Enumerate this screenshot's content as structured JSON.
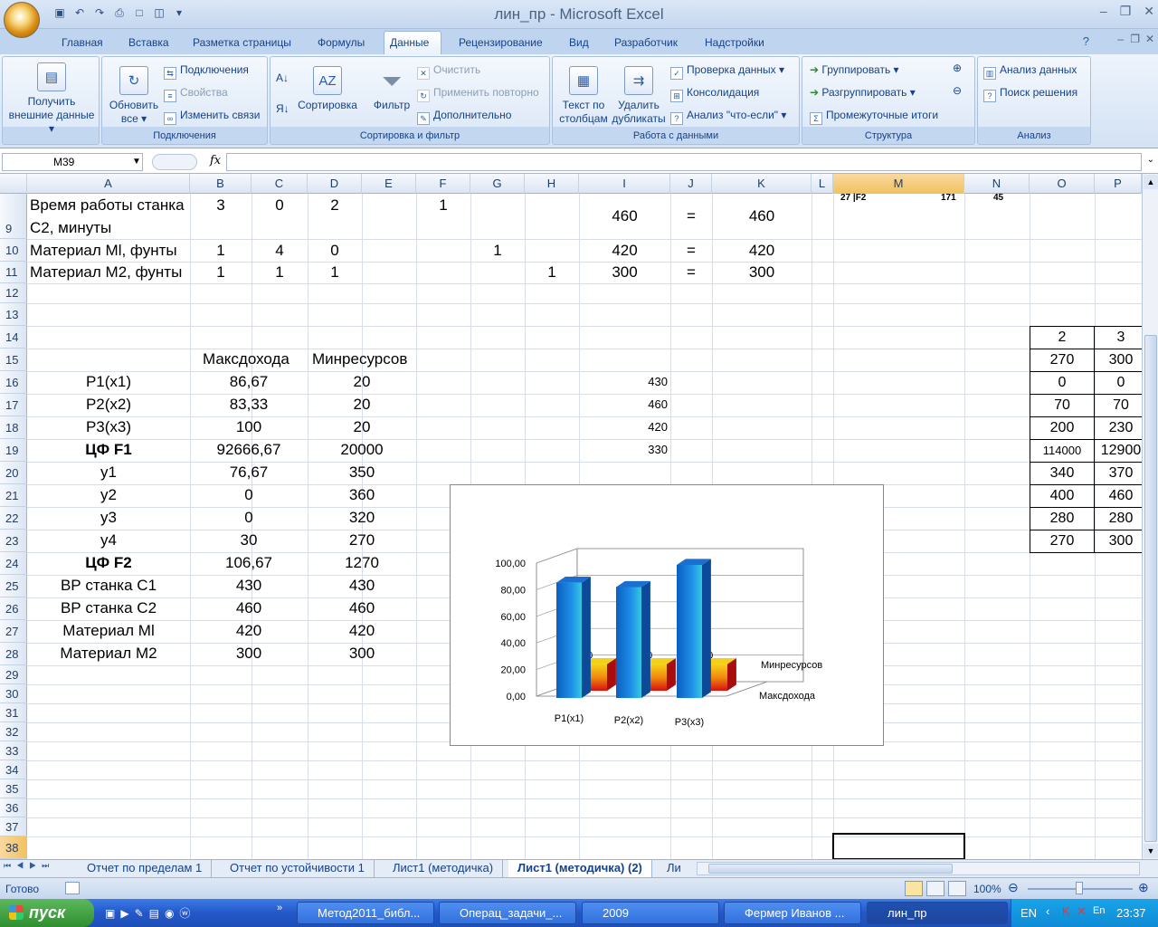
{
  "window": {
    "title": "лин_пр - Microsoft Excel"
  },
  "ribbon": {
    "tabs": [
      "Главная",
      "Вставка",
      "Разметка страницы",
      "Формулы",
      "Данные",
      "Рецензирование",
      "Вид",
      "Разработчик",
      "Надстройки"
    ],
    "active_tab": "Данные",
    "groups": {
      "connections_label": "Подключения",
      "sort_filter_label": "Сортировка и фильтр",
      "data_tools_label": "Работа с данными",
      "structure_label": "Структура",
      "analysis_label": "Анализ"
    },
    "buttons": {
      "get_external_1": "Получить",
      "get_external_2": "внешние данные",
      "refresh_1": "Обновить",
      "refresh_2": "все",
      "connections": "Подключения",
      "properties": "Свойства",
      "edit_links": "Изменить связи",
      "sort": "Сортировка",
      "filter": "Фильтр",
      "clear": "Очистить",
      "reapply": "Применить повторно",
      "advanced": "Дополнительно",
      "text_to_columns_1": "Текст по",
      "text_to_columns_2": "столбцам",
      "remove_dup_1": "Удалить",
      "remove_dup_2": "дубликаты",
      "data_validation": "Проверка данных",
      "consolidate": "Консолидация",
      "what_if": "Анализ \"что-если\"",
      "group": "Группировать",
      "ungroup": "Разгруппировать",
      "subtotal": "Промежуточные итоги",
      "data_analysis": "Анализ данных",
      "solver": "Поиск решения"
    }
  },
  "formula_bar": {
    "name_box": "M39",
    "fx": "fx",
    "formula": ""
  },
  "columns": [
    "A",
    "B",
    "C",
    "D",
    "E",
    "F",
    "G",
    "H",
    "I",
    "J",
    "K",
    "L",
    "M",
    "N",
    "O",
    "P"
  ],
  "rows_visible": [
    "9",
    "10",
    "11",
    "12",
    "13",
    "14",
    "15",
    "16",
    "17",
    "18",
    "19",
    "20",
    "21",
    "22",
    "23",
    "24",
    "25",
    "26",
    "27",
    "28",
    "29",
    "30",
    "31",
    "32",
    "33",
    "34",
    "35",
    "36",
    "37",
    "38"
  ],
  "cells": {
    "r9": {
      "A1": "Время работы станка",
      "A2": "С2, минуты",
      "B": "3",
      "C": "0",
      "D": "2",
      "F": "1",
      "I": "460",
      "J": "=",
      "K": "460"
    },
    "r10": {
      "A": "Материал Ml, фунты",
      "B": "1",
      "C": "4",
      "D": "0",
      "G": "1",
      "I": "420",
      "J": "=",
      "K": "420"
    },
    "r11": {
      "A": "Материал М2, фунты",
      "B": "1",
      "C": "1",
      "D": "1",
      "H": "1",
      "I": "300",
      "J": "=",
      "K": "300"
    },
    "overflow_top": {
      "M": "27 |F2",
      "M2": "171",
      "N": "45"
    },
    "r15": {
      "B": "Максдохода",
      "D": "Минресурсов"
    },
    "table": [
      {
        "A": "Р1(x1)",
        "B": "86,67",
        "D": "20",
        "I": "430",
        "bold": false
      },
      {
        "A": "Р2(x2)",
        "B": "83,33",
        "D": "20",
        "I": "460",
        "bold": false
      },
      {
        "A": "Р3(x3)",
        "B": "100",
        "D": "20",
        "I": "420",
        "bold": false
      },
      {
        "A": "ЦФ F1",
        "B": "92666,67",
        "D": "20000",
        "I": "330",
        "bold": true
      },
      {
        "A": "y1",
        "B": "76,67",
        "D": "350",
        "I": "",
        "bold": false
      },
      {
        "A": "y2",
        "B": "0",
        "D": "360",
        "I": "",
        "bold": false
      },
      {
        "A": "y3",
        "B": "0",
        "D": "320",
        "I": "",
        "bold": false
      },
      {
        "A": "y4",
        "B": "30",
        "D": "270",
        "I": "",
        "bold": false
      },
      {
        "A": "ЦФ F2",
        "B": "106,67",
        "D": "1270",
        "I": "",
        "bold": true
      },
      {
        "A": "ВР станка С1",
        "B": "430",
        "D": "430",
        "I": "",
        "bold": false
      },
      {
        "A": "ВР станка С2",
        "B": "460",
        "D": "460",
        "I": "",
        "bold": false
      },
      {
        "A": "Материал Ml",
        "B": "420",
        "D": "420",
        "I": "",
        "bold": false
      },
      {
        "A": "Материал М2",
        "B": "300",
        "D": "300",
        "I": "",
        "bold": false
      }
    ],
    "side_table": [
      {
        "O": "2",
        "P": "3"
      },
      {
        "O": "270",
        "P": "300"
      },
      {
        "O": "0",
        "P": "0"
      },
      {
        "O": "70",
        "P": "70"
      },
      {
        "O": "200",
        "P": "230"
      },
      {
        "O": "114000",
        "P": "12900"
      },
      {
        "O": "340",
        "P": "370"
      },
      {
        "O": "400",
        "P": "460"
      },
      {
        "O": "280",
        "P": "280"
      },
      {
        "O": "270",
        "P": "300"
      }
    ]
  },
  "chart_data": {
    "type": "bar",
    "categories": [
      "Р1(x1)",
      "Р2(x2)",
      "Р3(x3)"
    ],
    "series": [
      {
        "name": "Максдохода",
        "values": [
          86.67,
          83.33,
          100
        ],
        "color": "#1e7fd8"
      },
      {
        "name": "Минресурсов",
        "values": [
          20,
          20,
          20
        ],
        "color": "#e8a312"
      }
    ],
    "yticks": [
      "0,00",
      "20,00",
      "40,00",
      "60,00",
      "80,00",
      "100,00"
    ],
    "ylim": [
      0,
      100
    ],
    "data_labels": [
      "20",
      "20",
      "20"
    ]
  },
  "sheet_tabs": [
    "Отчет по пределам 1",
    "Отчет по устойчивости 1",
    "Лист1 (методичка)",
    "Лист1 (методичка) (2)",
    "Ли"
  ],
  "active_sheet": "Лист1 (методичка) (2)",
  "status": {
    "ready": "Готово",
    "zoom": "100%"
  },
  "taskbar": {
    "start": "пуск",
    "items": [
      "Метод2011_библ...",
      "Операц_задачи_...",
      "2009",
      "Фермер Иванов ...",
      "лин_пр"
    ],
    "lang": "EN",
    "time": "23:37"
  }
}
